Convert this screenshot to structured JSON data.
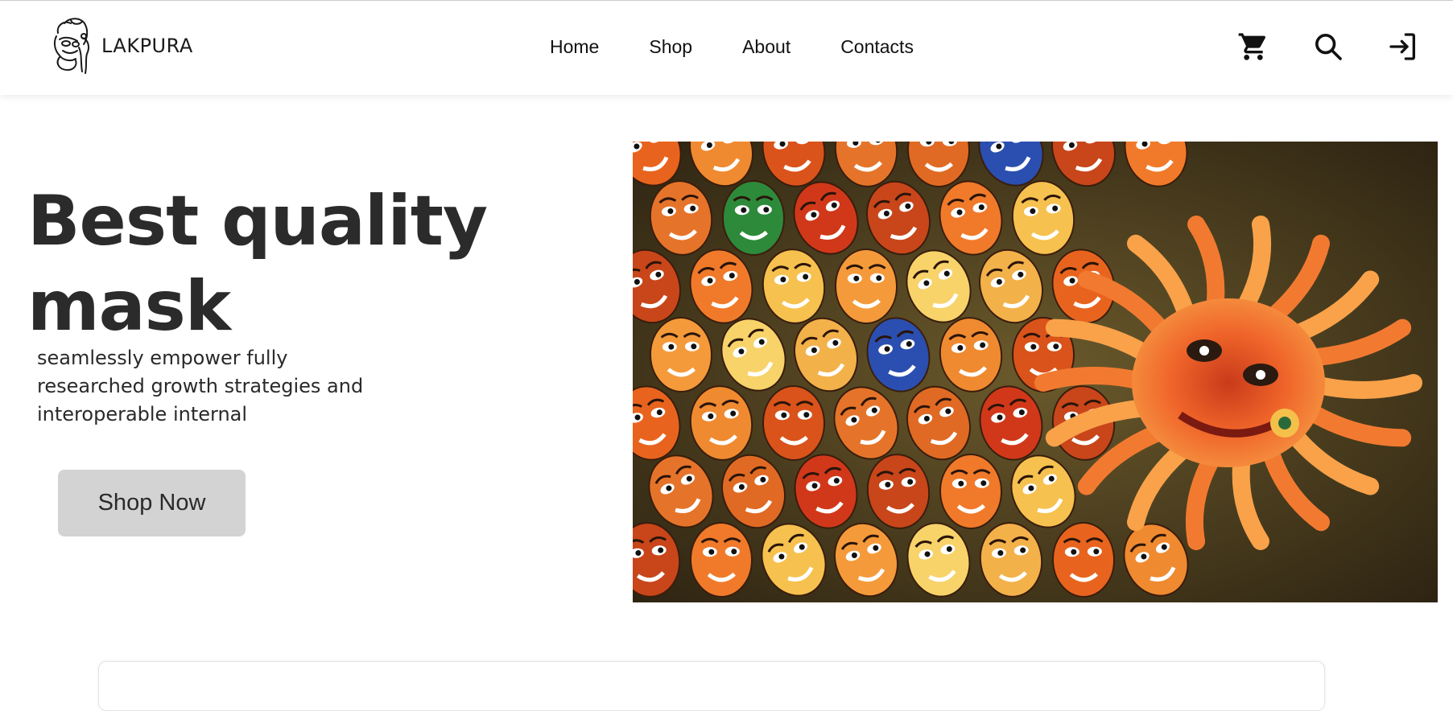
{
  "brand": {
    "name": "LAKPURA",
    "logo_icon": "mask-logo-icon"
  },
  "nav": {
    "links": [
      {
        "label": "Home"
      },
      {
        "label": "Shop"
      },
      {
        "label": "About"
      },
      {
        "label": "Contacts"
      }
    ],
    "icons": [
      "cart-icon",
      "search-icon",
      "login-icon"
    ]
  },
  "hero": {
    "title_line1": "Best quality",
    "title_line2": "mask",
    "description": "seamlessly empower fully researched growth strategies and interoperable internal",
    "button_label": "Shop Now",
    "image_subject": "colorful traditional masks"
  },
  "colors": {
    "button_bg": "#d3d3d3",
    "title_text": "#2b2b2b",
    "navbar_bg": "#ffffff"
  }
}
